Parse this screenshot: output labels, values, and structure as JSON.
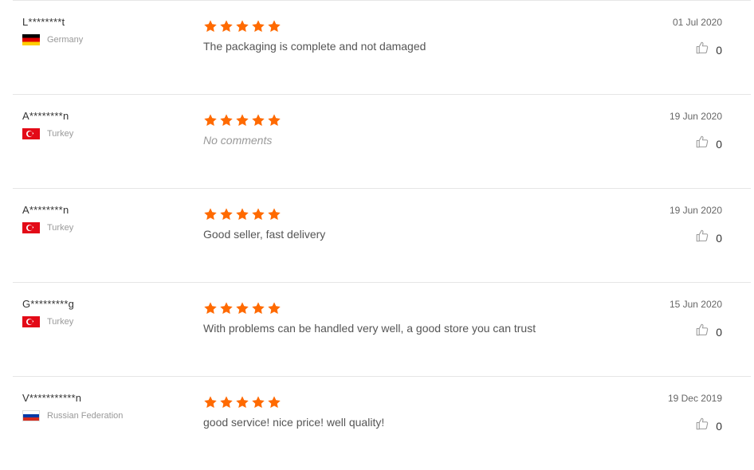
{
  "colors": {
    "star": "#ff6a00",
    "divider": "#e6e6e6"
  },
  "reviews": [
    {
      "name": "L********t",
      "country": "Germany",
      "flag": "de",
      "rating": 5,
      "comment": "The packaging is complete and not damaged",
      "empty": false,
      "date": "01 Jul 2020",
      "likes": "0"
    },
    {
      "name": "A********n",
      "country": "Turkey",
      "flag": "tr",
      "rating": 5,
      "comment": "No comments",
      "empty": true,
      "date": "19 Jun 2020",
      "likes": "0"
    },
    {
      "name": "A********n",
      "country": "Turkey",
      "flag": "tr",
      "rating": 5,
      "comment": "Good seller, fast delivery",
      "empty": false,
      "date": "19 Jun 2020",
      "likes": "0"
    },
    {
      "name": "G*********g",
      "country": "Turkey",
      "flag": "tr",
      "rating": 5,
      "comment": "With problems can be handled very well, a good store you can trust",
      "empty": false,
      "date": "15 Jun 2020",
      "likes": "0"
    },
    {
      "name": "V***********n",
      "country": "Russian Federation",
      "flag": "ru",
      "rating": 5,
      "comment": "good service!  nice price! well quality!",
      "empty": false,
      "date": "19 Dec 2019",
      "likes": "0"
    }
  ]
}
